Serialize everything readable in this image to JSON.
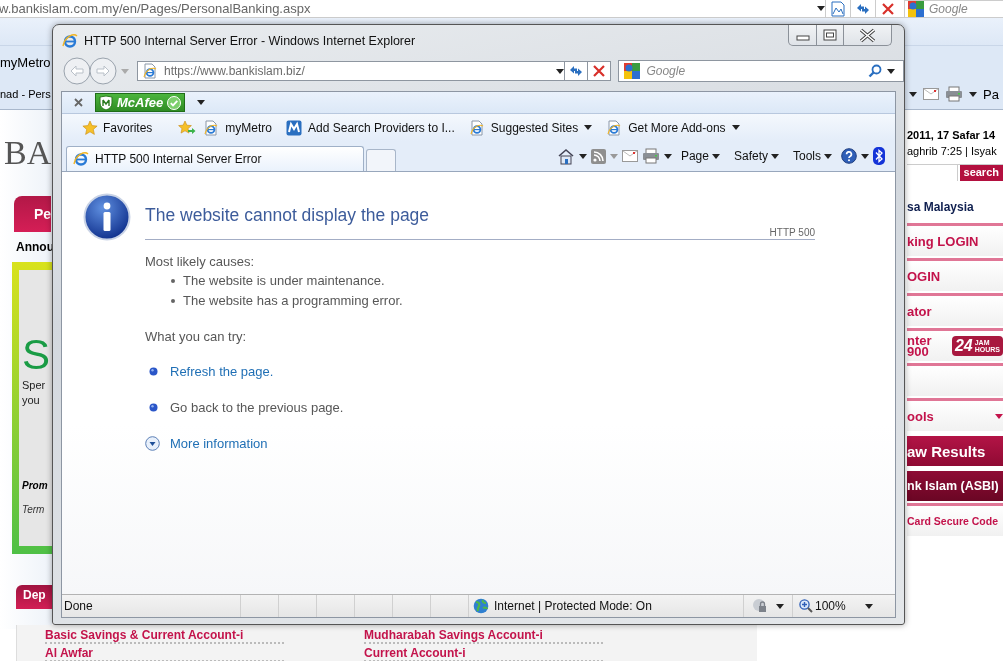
{
  "background_browser": {
    "address": "w.bankislam.com.my/en/Pages/PersonalBanking.aspx",
    "search_placeholder": "Google",
    "favorite": "myMetro",
    "tab_title": "nad - Pers",
    "command": "Pa",
    "page": {
      "logo": "BA",
      "section_tab": "Pe",
      "announcements_heading": "Annou",
      "banner": {
        "headline": "S",
        "lines": [
          "Sper",
          "you"
        ],
        "promo": "Prom",
        "terms": "Term"
      },
      "date": "2011, 17 Safar 14",
      "prayer_times": "aghrib 7:25 | Isyak",
      "search_button": "search",
      "language": "sa Malaysia",
      "side_menu": [
        {
          "kind": "link",
          "text": "king LOGIN"
        },
        {
          "kind": "link",
          "text": "OGIN"
        },
        {
          "kind": "link",
          "text": "ator"
        },
        {
          "kind": "hotline",
          "lines": [
            "nter",
            "900"
          ],
          "badge": {
            "number": "24",
            "top": "JAM",
            "bottom": "HOURS"
          }
        },
        {
          "kind": "blank"
        },
        {
          "kind": "dropdown",
          "text": "ools"
        },
        {
          "kind": "banner",
          "text": "aw Results"
        },
        {
          "kind": "banner_dark",
          "text": "nk Islam (ASBI)"
        },
        {
          "kind": "link",
          "text": "Card Secure Code"
        }
      ],
      "deposits_heading": "Dep",
      "products": [
        {
          "left": "Basic Savings & Current Account-i",
          "right": "Mudharabah Savings Account-i"
        },
        {
          "left": "Al Awfar",
          "right": "Current Account-i"
        }
      ]
    }
  },
  "window": {
    "title": "HTTP 500 Internal Server Error - Windows Internet Explorer",
    "address": "https://www.bankislam.biz/",
    "search_placeholder": "Google",
    "addon": "McAfee",
    "favorites_button": "Favorites",
    "favorites": [
      {
        "label": "myMetro",
        "kind": "page",
        "dropdown": false
      },
      {
        "label": "Add Search Providers to I...",
        "kind": "tile",
        "dropdown": false
      },
      {
        "label": "Suggested Sites",
        "kind": "page",
        "dropdown": true
      },
      {
        "label": "Get More Add-ons",
        "kind": "page",
        "dropdown": true
      }
    ],
    "tabs": [
      {
        "title": "HTTP 500 Internal Server Error",
        "selected": true
      }
    ],
    "commands": [
      "Page",
      "Safety",
      "Tools"
    ],
    "content": {
      "heading": "The website cannot display the page",
      "code": "HTTP 500",
      "causes_heading": "Most likely causes:",
      "causes": [
        "The website is under maintenance.",
        "The website has a programming error."
      ],
      "try_heading": "What you can try:",
      "actions": [
        {
          "kind": "link",
          "text": "Refresh the page."
        },
        {
          "kind": "text",
          "text": "Go back to the previous page."
        },
        {
          "kind": "expand",
          "text": "More information"
        }
      ]
    },
    "status": {
      "text": "Done",
      "zone": "Internet | Protected Mode: On",
      "zoom": "100%"
    }
  }
}
